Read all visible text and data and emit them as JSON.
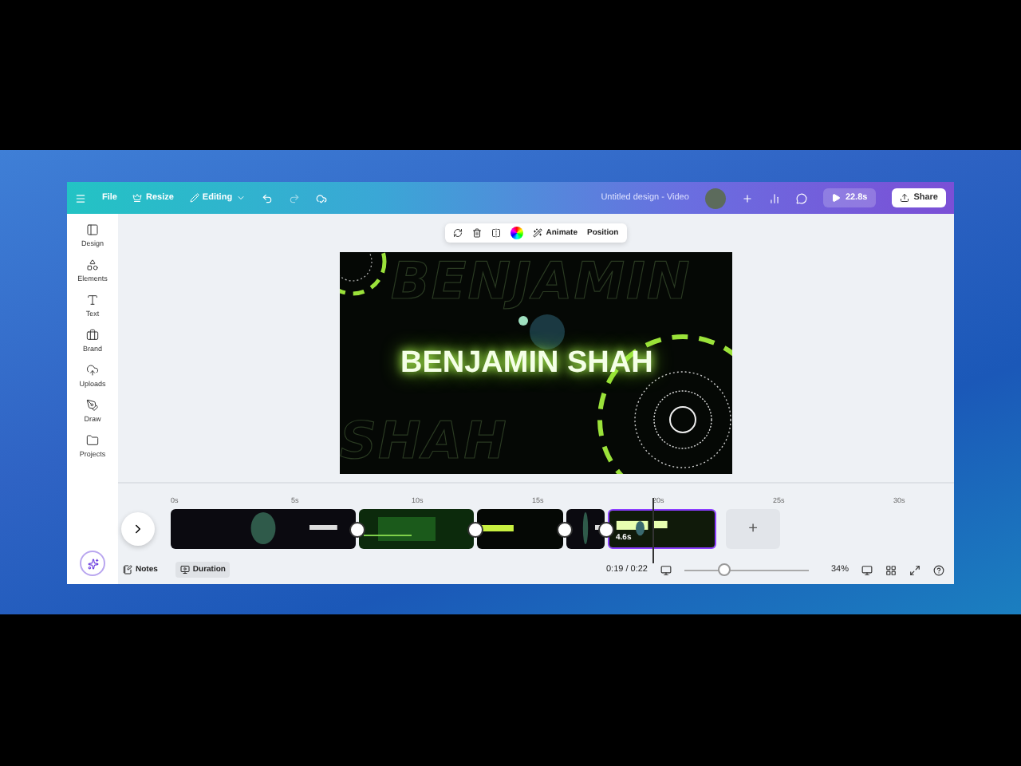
{
  "topbar": {
    "menu": [
      "File",
      "Resize",
      "Editing"
    ],
    "title": "Untitled design - Video",
    "timer": "22.8s",
    "share": "Share"
  },
  "sidebar": [
    {
      "label": "Design",
      "kind": "design"
    },
    {
      "label": "Elements",
      "kind": "elements"
    },
    {
      "label": "Text",
      "kind": "text"
    },
    {
      "label": "Brand",
      "kind": "brand"
    },
    {
      "label": "Uploads",
      "kind": "uploads"
    },
    {
      "label": "Draw",
      "kind": "draw"
    },
    {
      "label": "Projects",
      "kind": "projects"
    }
  ],
  "toolbar": {
    "buttons": [
      "Animate",
      "Position"
    ]
  },
  "canvas": {
    "outline_top": "BENJAMIN",
    "headline": "BENJAMIN SHAH",
    "outline_bottom": "SHAH"
  },
  "timeline": {
    "ticks": [
      "0s",
      "5s",
      "10s",
      "15s",
      "20s",
      "25s",
      "30s"
    ],
    "clips": [
      {
        "kind": "dark",
        "selected": false
      },
      {
        "kind": "green",
        "selected": false
      },
      {
        "kind": "banner",
        "selected": false
      },
      {
        "kind": "dark",
        "selected": false
      },
      {
        "kind": "title",
        "selected": true,
        "duration": "4.6s"
      }
    ],
    "add": "+"
  },
  "bottombar": {
    "notes": "Notes",
    "duration": {
      "label": "Duration",
      "selected": true
    },
    "time": "0:19 / 0:22",
    "zoom": {
      "level": 0.32
    },
    "zoom_label": "34%"
  }
}
